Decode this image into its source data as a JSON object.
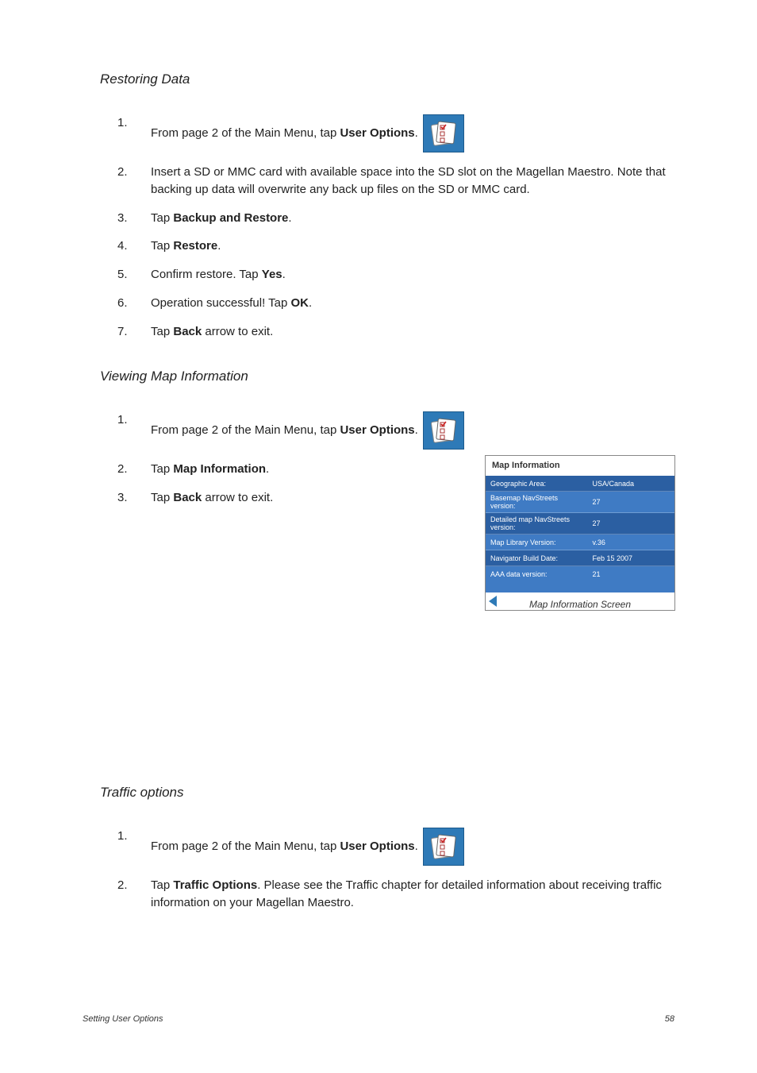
{
  "sections": {
    "restoring": {
      "heading": "Restoring Data",
      "steps": [
        {
          "num": "1.",
          "pre": "From page 2 of the Main Menu, tap ",
          "bold": "User Options",
          "post": "."
        },
        {
          "num": "2.",
          "text": "Insert a SD or MMC card with available space into the SD slot on the Magellan Maestro. Note that backing up data will overwrite any back up files on the SD or MMC card."
        },
        {
          "num": "3.",
          "pre": "Tap ",
          "bold": "Backup and Restore",
          "post": "."
        },
        {
          "num": "4.",
          "pre": "Tap ",
          "bold": "Restore",
          "post": "."
        },
        {
          "num": "5.",
          "pre": "Confirm restore.  Tap ",
          "bold": "Yes",
          "post": "."
        },
        {
          "num": "6.",
          "pre": "Operation successful!  Tap ",
          "bold": "OK",
          "post": "."
        },
        {
          "num": "7.",
          "pre": "Tap ",
          "bold": "Back",
          "post": " arrow to exit."
        }
      ]
    },
    "viewing": {
      "heading": "Viewing Map Information",
      "steps": [
        {
          "num": "1.",
          "pre": "From page 2 of the Main Menu, tap ",
          "bold": "User Options",
          "post": "."
        },
        {
          "num": "2.",
          "pre": "Tap ",
          "bold": "Map Information",
          "post": "."
        },
        {
          "num": "3.",
          "pre": "Tap ",
          "bold": "Back",
          "post": " arrow to exit."
        }
      ]
    },
    "traffic": {
      "heading": "Traffic options",
      "steps": [
        {
          "num": "1.",
          "pre": "From page 2 of the Main Menu, tap ",
          "bold": "User Options",
          "post": "."
        },
        {
          "num": "2.",
          "pre": "Tap ",
          "bold": "Traffic Options",
          "post": ". Please see the Traffic chapter for detailed information about receiving traffic information on your Magellan Maestro."
        }
      ]
    }
  },
  "map_info": {
    "title": "Map Information",
    "caption": "Map Information Screen",
    "rows": [
      {
        "k": "Geographic Area:",
        "v": "USA/Canada"
      },
      {
        "k": "Basemap NavStreets version:",
        "v": "27"
      },
      {
        "k": "Detailed map NavStreets version:",
        "v": "27"
      },
      {
        "k": "Map Library Version:",
        "v": "v.36"
      },
      {
        "k": "Navigator Build Date:",
        "v": "Feb 15 2007"
      },
      {
        "k": "AAA data version:",
        "v": "21"
      }
    ]
  },
  "footer": {
    "left": "Setting User Options",
    "right": "58"
  },
  "icons": {
    "user_options": "user-options-icon"
  }
}
